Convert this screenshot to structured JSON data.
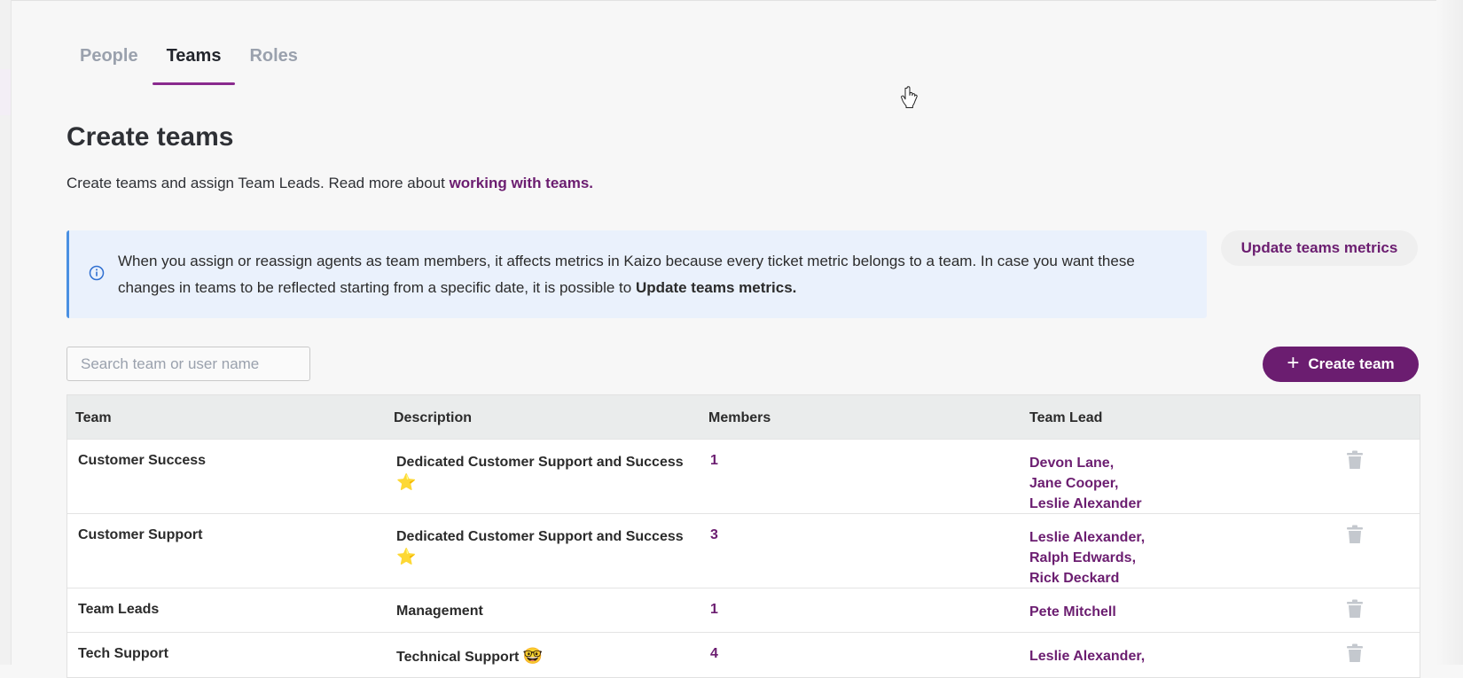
{
  "tabs": [
    {
      "label": "People",
      "active": false
    },
    {
      "label": "Teams",
      "active": true
    },
    {
      "label": "Roles",
      "active": false
    }
  ],
  "page": {
    "title": "Create teams",
    "subtitle_prefix": "Create teams and assign Team Leads. Read more about ",
    "subtitle_link": "working with teams."
  },
  "banner": {
    "icon": "info-icon",
    "text": "When you assign or reassign agents as team members, it affects metrics in Kaizo because every ticket metric belongs to a team. In case you want these changes in teams to be reflected starting from a specific date, it is possible to ",
    "bold_text": "Update teams metrics."
  },
  "update_metrics_button": "Update teams metrics",
  "search": {
    "placeholder": "Search team or user name",
    "value": ""
  },
  "create_team_button": {
    "icon": "plus-icon",
    "label": "Create team"
  },
  "table": {
    "headers": {
      "team": "Team",
      "description": "Description",
      "members": "Members",
      "lead": "Team Lead"
    },
    "rows": [
      {
        "team": "Customer Success",
        "description": "Dedicated Customer Support and Success",
        "emoji": "⭐",
        "members": "1",
        "leads": [
          "Devon Lane,",
          "Jane Cooper,",
          "Leslie Alexander"
        ]
      },
      {
        "team": "Customer Support",
        "description": "Dedicated Customer Support and Success",
        "emoji": "⭐",
        "members": "3",
        "leads": [
          "Leslie Alexander,",
          "Ralph Edwards,",
          "Rick Deckard"
        ]
      },
      {
        "team": "Team Leads",
        "description": "Management",
        "emoji": "",
        "members": "1",
        "leads": [
          "Pete Mitchell"
        ]
      },
      {
        "team": "Tech Support",
        "description": "Technical Support",
        "emoji": "🤓",
        "members": "4",
        "leads": [
          "Leslie Alexander,"
        ]
      }
    ]
  },
  "colors": {
    "brand": "#6b1d70",
    "tab_underline": "#8a2a8e",
    "banner_bg": "#eaf1fc",
    "banner_border": "#4a90e2"
  }
}
